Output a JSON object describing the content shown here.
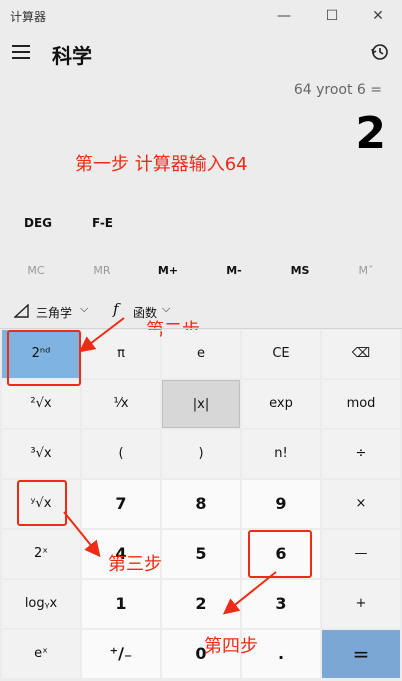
{
  "window": {
    "title": "计算器",
    "minimize": "—",
    "maximize": "☐",
    "close": "✕"
  },
  "header": {
    "mode": "科学",
    "menu_icon": "hamburger-icon",
    "history_icon": "history-icon"
  },
  "display": {
    "expression": "64 yroot 6 =",
    "result": "2"
  },
  "modes": {
    "deg": "DEG",
    "fe": "F-E"
  },
  "memory": [
    "MC",
    "MR",
    "M+",
    "M-",
    "MS",
    "Mˇ"
  ],
  "tools": {
    "trig": "三角学",
    "func": "函数"
  },
  "annotations": {
    "step1": "第一步  计算器输入64",
    "step2": "第二步",
    "step3": "第三步",
    "step4": "第四步"
  },
  "keys": {
    "r0": [
      "2ⁿᵈ",
      "π",
      "e",
      "CE",
      "⌫"
    ],
    "r1": [
      "²√x",
      "¹⁄x",
      "|x|",
      "exp",
      "mod"
    ],
    "r2": [
      "³√x",
      "(",
      ")",
      "n!",
      "÷"
    ],
    "r3": [
      "ʸ√x",
      "7",
      "8",
      "9",
      "×"
    ],
    "r4": [
      "2ˣ",
      "4",
      "5",
      "6",
      "—"
    ],
    "r5": [
      "logᵧx",
      "1",
      "2",
      "3",
      "+"
    ],
    "r6": [
      "eˣ",
      "⁺∕₋",
      "0",
      ".",
      "="
    ]
  }
}
